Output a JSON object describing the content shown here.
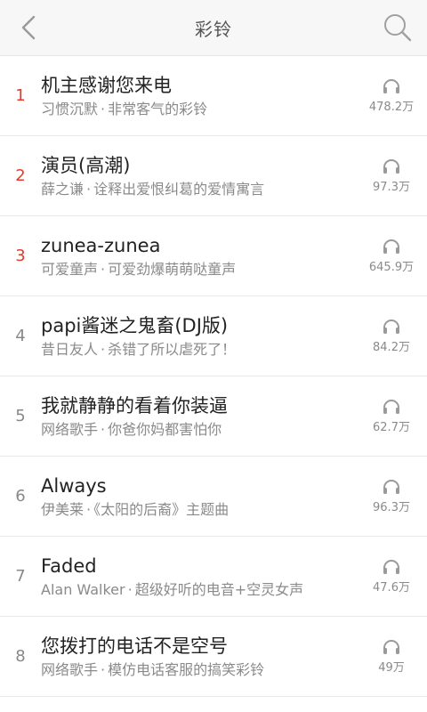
{
  "header": {
    "title": "彩铃",
    "back_icon": "back-chevron-icon",
    "search_icon": "search-icon"
  },
  "colors": {
    "accent_rank": "#e23b2e",
    "header_bg": "#f7f7f7"
  },
  "items": [
    {
      "rank": "1",
      "title": "机主感谢您来电",
      "artist": "习惯沉默",
      "desc": "非常客气的彩铃",
      "plays": "478.2万",
      "highlight": true
    },
    {
      "rank": "2",
      "title": "演员(高潮)",
      "artist": "薛之谦",
      "desc": "诠释出爱恨纠葛的爱情寓言",
      "plays": "97.3万",
      "highlight": true
    },
    {
      "rank": "3",
      "title": "zunea-zunea",
      "artist": "可爱童声",
      "desc": "可爱劲爆萌萌哒童声",
      "plays": "645.9万",
      "highlight": true
    },
    {
      "rank": "4",
      "title": "papi酱迷之鬼畜(DJ版)",
      "artist": "昔日友人",
      "desc": "杀错了所以虐死了！",
      "plays": "84.2万",
      "highlight": false
    },
    {
      "rank": "5",
      "title": "我就静静的看着你装逼",
      "artist": "网络歌手",
      "desc": "你爸你妈都害怕你",
      "plays": "62.7万",
      "highlight": false
    },
    {
      "rank": "6",
      "title": "Always",
      "artist": "伊美莱",
      "desc": "《太阳的后裔》主题曲",
      "plays": "96.3万",
      "highlight": false
    },
    {
      "rank": "7",
      "title": "Faded",
      "artist": "Alan Walker",
      "desc": "超级好听的电音+空灵女声",
      "plays": "47.6万",
      "highlight": false
    },
    {
      "rank": "8",
      "title": "您拨打的电话不是空号",
      "artist": "网络歌手",
      "desc": "模仿电话客服的搞笑彩铃",
      "plays": "49万",
      "highlight": false
    }
  ]
}
